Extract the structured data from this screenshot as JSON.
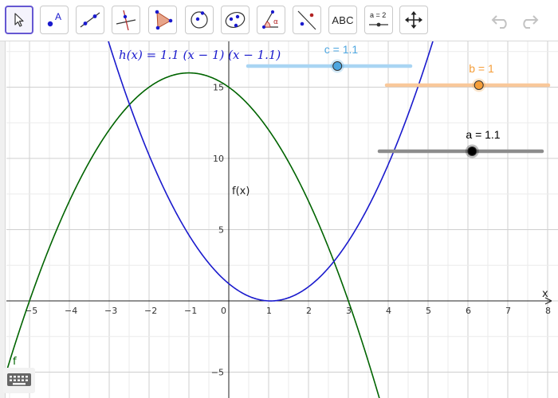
{
  "toolbar": {
    "tools": [
      {
        "name": "move-tool",
        "active": true
      },
      {
        "name": "point-tool",
        "label": "A"
      },
      {
        "name": "line-tool"
      },
      {
        "name": "perpendicular-line-tool"
      },
      {
        "name": "polygon-tool"
      },
      {
        "name": "circle-center-point-tool"
      },
      {
        "name": "ellipse-tool"
      },
      {
        "name": "angle-tool",
        "label": "α"
      },
      {
        "name": "reflect-tool"
      },
      {
        "name": "text-tool",
        "label": "ABC"
      },
      {
        "name": "slider-tool",
        "label": "a = 2"
      },
      {
        "name": "move-graphics-view-tool"
      }
    ],
    "undo_icon": "undo-icon",
    "redo_icon": "redo-icon"
  },
  "graph": {
    "x_axis_label": "x",
    "y_axis_label": "f(x)",
    "x_range": [
      -5.5,
      7.2
    ],
    "y_range": [
      -6.5,
      17
    ],
    "x_ticks": [
      "−5",
      "−4",
      "−3",
      "−2",
      "−1",
      "0",
      "1",
      "2",
      "3",
      "4",
      "5",
      "6",
      "7",
      "8"
    ],
    "y_ticks": [
      "15",
      "10",
      "5",
      "−5"
    ],
    "functions": [
      {
        "name": "f",
        "label": "f",
        "color": "#006400",
        "expression": "-(x+1)^2 + 16"
      },
      {
        "name": "h",
        "formula_text": "h(x)  =  1.1  (x − 1)  (x − 1.1)",
        "color": "#1a1acd"
      }
    ],
    "sliders": [
      {
        "name": "c",
        "label": "c = 1.1",
        "value": 1.1,
        "fraction": 0.55,
        "color": "#4da6e0",
        "track_color": "#a9d5f3"
      },
      {
        "name": "b",
        "label": "b = 1",
        "value": 1,
        "fraction": 0.57,
        "color": "#f59e3a",
        "track_color": "#f9c89a"
      },
      {
        "name": "a",
        "label": "a = 1.1",
        "value": 1.1,
        "fraction": 0.57,
        "color": "#000000",
        "track_color": "#8c8c8c"
      }
    ]
  },
  "keyboard_icon": "keyboard-icon"
}
